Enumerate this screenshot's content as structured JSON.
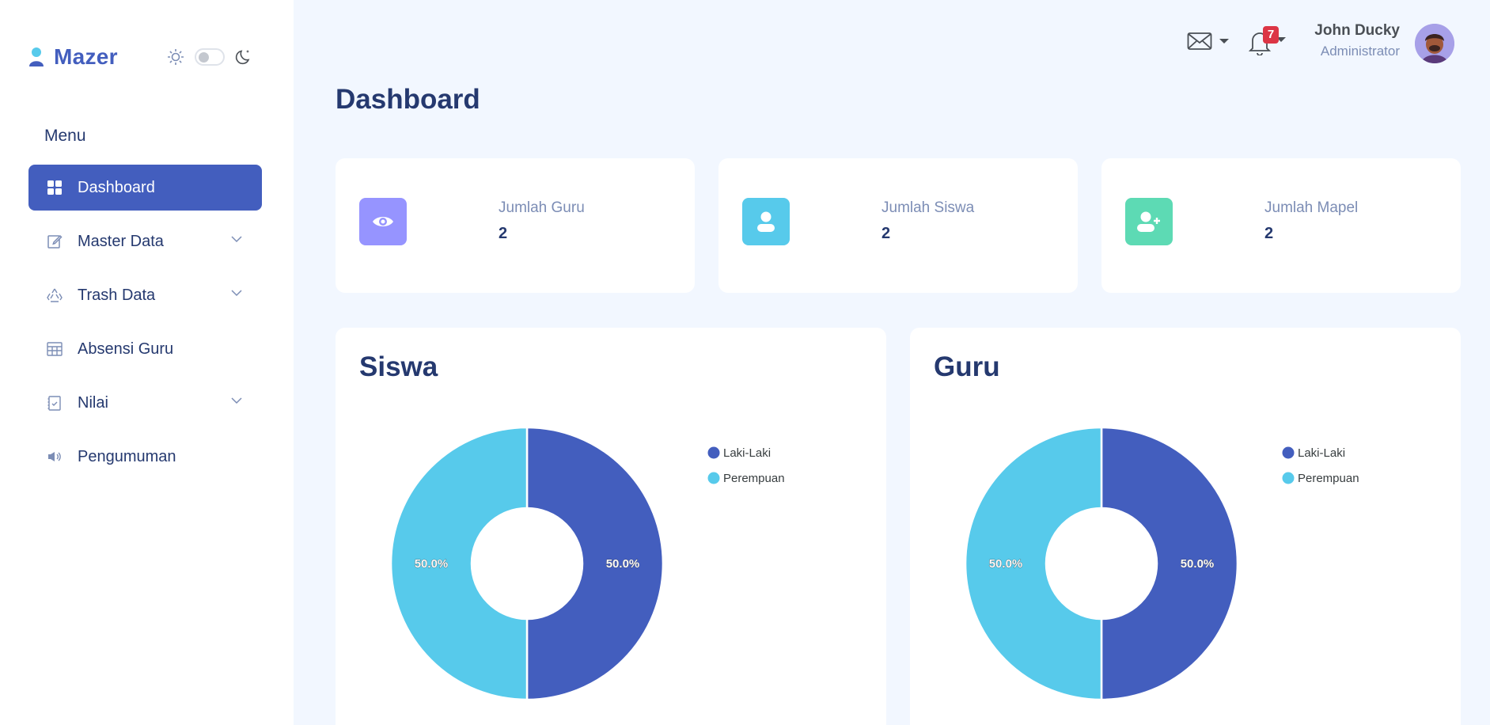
{
  "app": {
    "name": "Mazer"
  },
  "sidebar": {
    "menu_title": "Menu",
    "items": [
      {
        "label": "Dashboard",
        "icon": "grid-icon",
        "active": true,
        "has_submenu": false
      },
      {
        "label": "Master Data",
        "icon": "pencil-square-icon",
        "active": false,
        "has_submenu": true
      },
      {
        "label": "Trash Data",
        "icon": "recycle-icon",
        "active": false,
        "has_submenu": true
      },
      {
        "label": "Absensi Guru",
        "icon": "table-icon",
        "active": false,
        "has_submenu": false
      },
      {
        "label": "Nilai",
        "icon": "clipboard-check-icon",
        "active": false,
        "has_submenu": true
      },
      {
        "label": "Pengumuman",
        "icon": "megaphone-icon",
        "active": false,
        "has_submenu": false
      }
    ]
  },
  "topbar": {
    "notification_count": "7",
    "user_name": "John Ducky",
    "user_role": "Administrator"
  },
  "page": {
    "title": "Dashboard"
  },
  "stats": [
    {
      "label": "Jumlah Guru",
      "value": "2",
      "icon": "eye-icon",
      "color": "#9694ff"
    },
    {
      "label": "Jumlah Siswa",
      "value": "2",
      "icon": "person-icon",
      "color": "#57caeb"
    },
    {
      "label": "Jumlah Mapel",
      "value": "2",
      "icon": "person-plus-icon",
      "color": "#5ddab4"
    }
  ],
  "colors": {
    "primary": "#435ebe",
    "secondary": "#57caeb",
    "danger": "#dc3545"
  },
  "chart_data": [
    {
      "type": "pie",
      "donut": true,
      "title": "Siswa",
      "categories": [
        "Laki-Laki",
        "Perempuan"
      ],
      "values": [
        50,
        50
      ],
      "data_labels": [
        "50.0%",
        "50.0%"
      ],
      "colors": [
        "#435ebe",
        "#57caeb"
      ],
      "legend": "top-right"
    },
    {
      "type": "pie",
      "donut": true,
      "title": "Guru",
      "categories": [
        "Laki-Laki",
        "Perempuan"
      ],
      "values": [
        50,
        50
      ],
      "data_labels": [
        "50.0%",
        "50.0%"
      ],
      "colors": [
        "#435ebe",
        "#57caeb"
      ],
      "legend": "top-right"
    }
  ]
}
